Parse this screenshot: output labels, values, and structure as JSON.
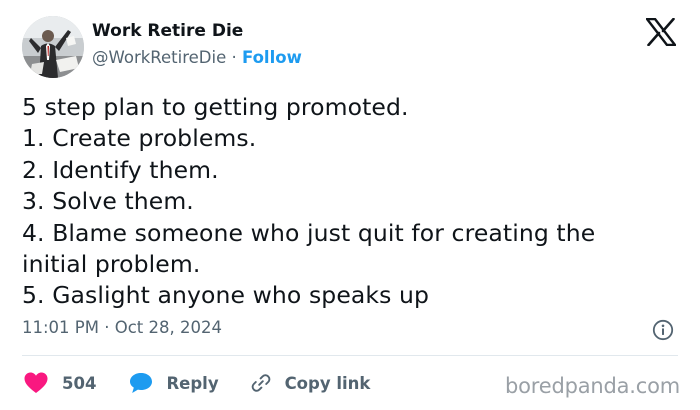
{
  "author": {
    "display_name": "Work Retire Die",
    "handle": "@WorkRetireDie",
    "separator": "·",
    "follow_label": "Follow"
  },
  "tweet": {
    "lines": [
      "5 step plan to getting promoted.",
      "1. Create problems.",
      "2. Identify them.",
      "3. Solve them.",
      "4. Blame someone who just quit for creating the",
      "initial problem.",
      "5. Gaslight anyone who speaks up"
    ],
    "time": "11:01 PM",
    "separator": "·",
    "date": "Oct 28, 2024"
  },
  "actions": {
    "like_count": "504",
    "reply_label": "Reply",
    "copy_link_label": "Copy link"
  },
  "watermark": "boredpanda.com",
  "icons": {
    "platform": "x-logo-icon",
    "info": "info-icon",
    "like": "heart-icon",
    "reply": "speech-bubble-icon",
    "copy": "link-icon"
  },
  "colors": {
    "text": "#0f1419",
    "secondary": "#536471",
    "accent": "#1d9bf0",
    "heart": "#f91880",
    "divider": "#e1e8ed",
    "watermark": "#9aa0a6"
  }
}
